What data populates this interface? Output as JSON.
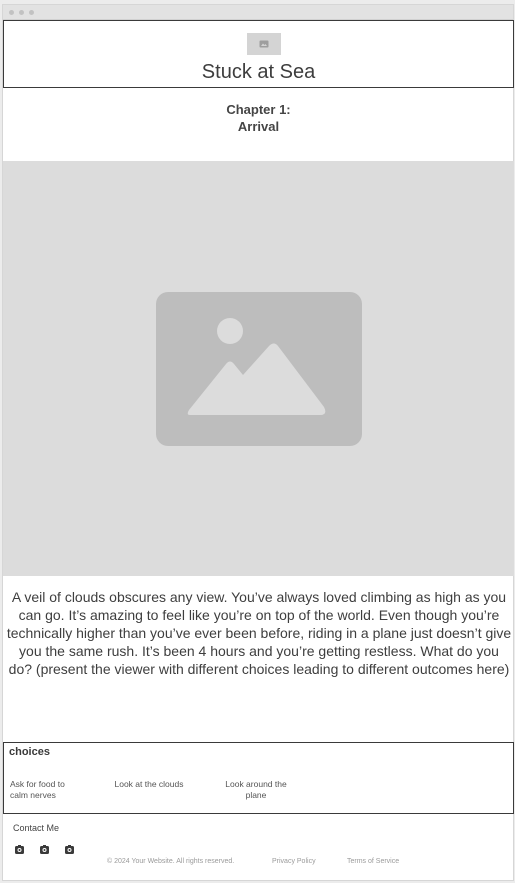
{
  "header": {
    "title": "Stuck at Sea",
    "logo_icon": "image-placeholder-icon"
  },
  "chapter": {
    "line1": "Chapter 1:",
    "line2": "Arrival"
  },
  "hero": {
    "icon": "image-placeholder-icon"
  },
  "story": {
    "text": "A veil of clouds obscures any view. You’ve always loved climbing as high as you can go. It’s amazing to feel like you’re on top of the world. Even though you’re technically higher than you’ve ever been before, riding in a plane just doesn’t give you the same rush. It’s been 4 hours and you’re getting restless. What do you do? (present the viewer with different choices leading to different outcomes here)"
  },
  "choices": {
    "title": "choices",
    "items": [
      {
        "label": "Ask for food to calm nerves"
      },
      {
        "label": "Look at the clouds"
      },
      {
        "label": "Look around the plane"
      }
    ]
  },
  "footer": {
    "contact": "Contact Me",
    "social_icons": [
      "instagram-icon",
      "instagram-icon",
      "instagram-icon"
    ],
    "copyright": "© 2024 Your Website. All rights reserved.",
    "privacy": "Privacy Policy",
    "terms": "Terms of Service"
  },
  "colors": {
    "placeholder_bg": "#dcdcdc",
    "placeholder_shape": "#bdbdbd",
    "border": "#3a3a3a"
  }
}
